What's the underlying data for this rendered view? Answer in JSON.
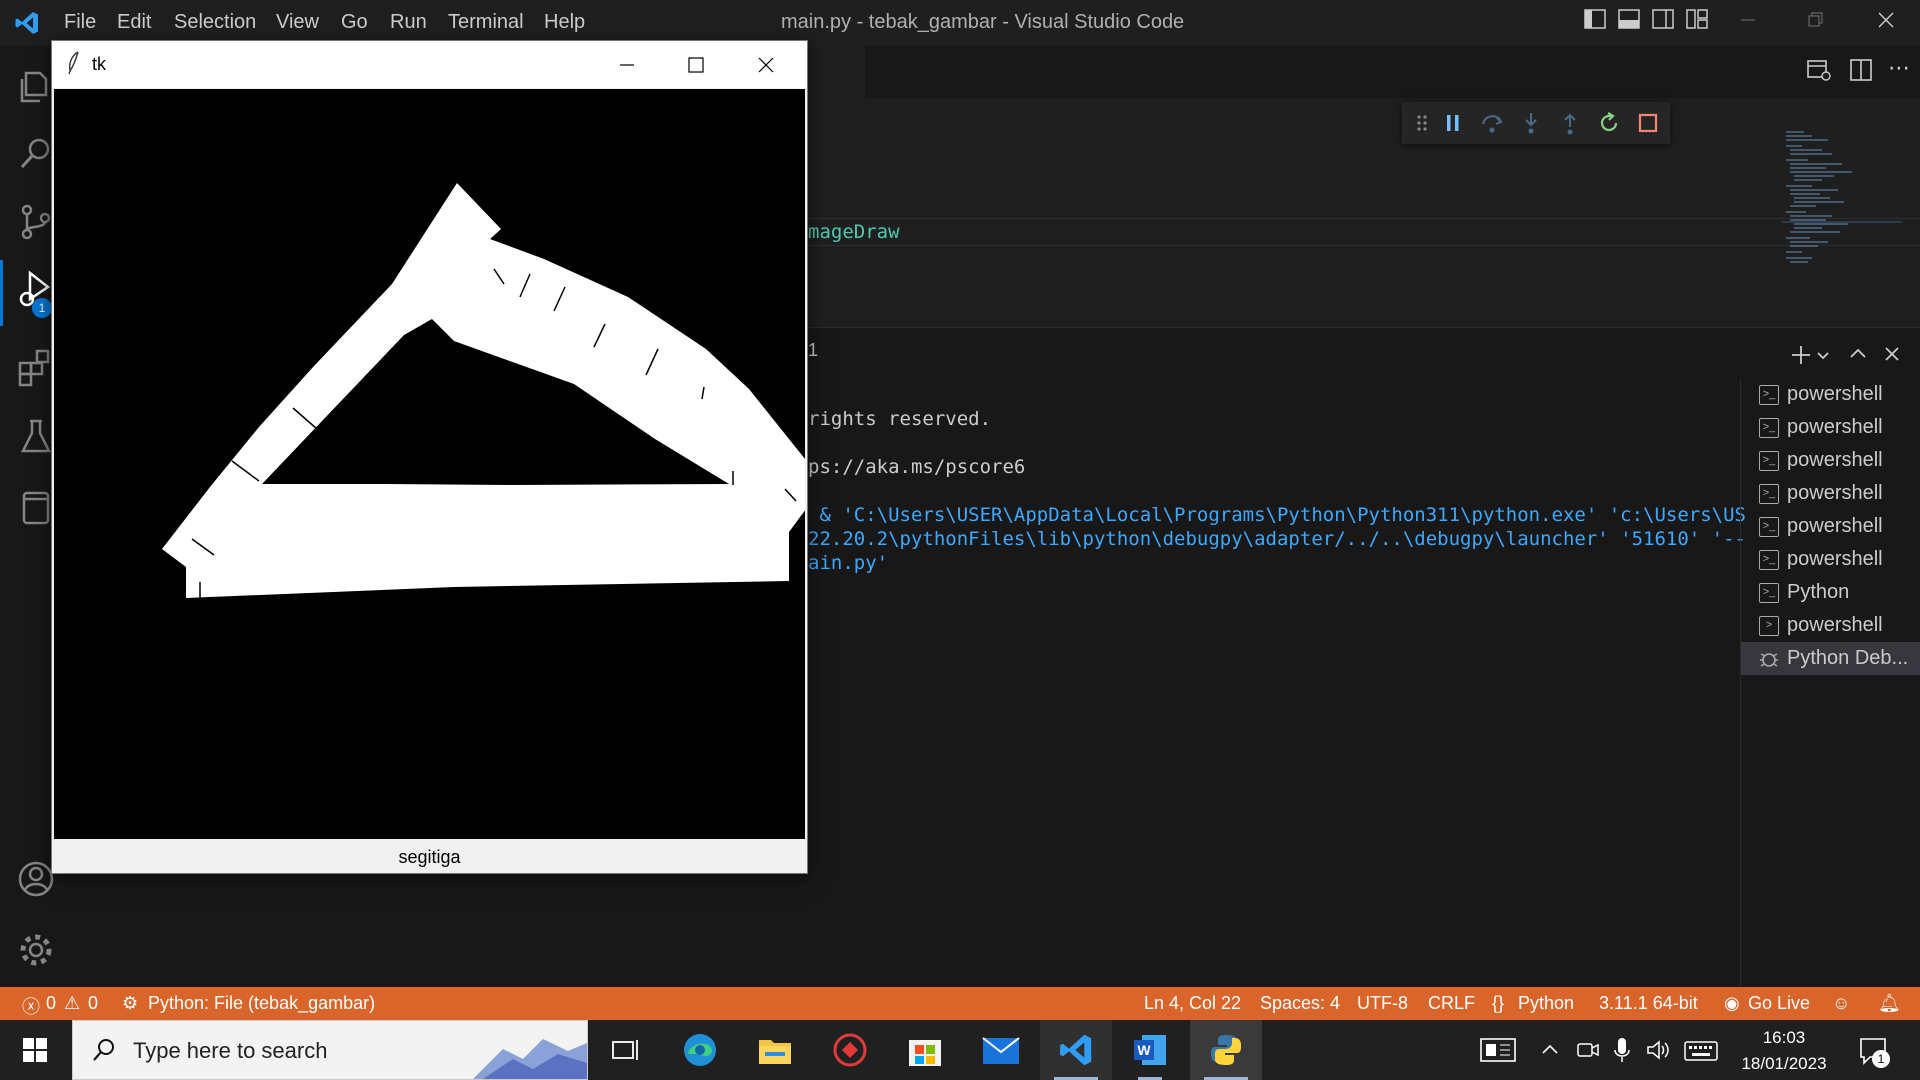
{
  "vscode": {
    "menu": [
      "File",
      "Edit",
      "Selection",
      "View",
      "Go",
      "Run",
      "Terminal",
      "Help"
    ],
    "window_title": "main.py - tebak_gambar - Visual Studio Code",
    "editor_fragment": "mageDraw",
    "terminal_lines": [
      "rights reserved.",
      "ps://aka.ms/pscore6",
      " & 'C:\\Users\\USER\\AppData\\Local\\Programs\\Python\\Python311\\python.exe' 'c:\\Users\\US",
      "22.20.2\\pythonFiles\\lib\\python\\debugpy\\adapter/../..\\debugpy\\launcher' '51610' '--",
      "ain.py'"
    ],
    "terminal_panel_fragment": "1",
    "terminals": [
      {
        "label": "powershell",
        "icon": "terminal-icon"
      },
      {
        "label": "powershell",
        "icon": "terminal-icon"
      },
      {
        "label": "powershell",
        "icon": "terminal-icon"
      },
      {
        "label": "powershell",
        "icon": "terminal-icon"
      },
      {
        "label": "powershell",
        "icon": "terminal-icon"
      },
      {
        "label": "powershell",
        "icon": "terminal-icon"
      },
      {
        "label": "Python",
        "icon": "terminal-icon"
      },
      {
        "label": "powershell",
        "icon": "terminal-icon"
      },
      {
        "label": "Python Deb...",
        "icon": "bug-icon",
        "active": true
      }
    ],
    "debug_badge": "1",
    "status": {
      "errors": "0",
      "warnings": "0",
      "debug_config": "Python: File (tebak_gambar)",
      "position": "Ln 4, Col 22",
      "spaces": "Spaces: 4",
      "encoding": "UTF-8",
      "eol": "CRLF",
      "language": "Python",
      "interpreter": "3.11.1 64-bit",
      "golive": "Go Live"
    },
    "colors": {
      "status_bar": "#d9652b",
      "accent": "#0078d4"
    }
  },
  "tk_window": {
    "title": "tk",
    "label": "segitiga"
  },
  "taskbar": {
    "search_placeholder": "Type here to search",
    "time": "16:03",
    "date": "18/01/2023",
    "notification_count": "1",
    "apps": [
      "task-view",
      "edge",
      "file-explorer",
      "security-app",
      "microsoft-store",
      "mail",
      "vscode",
      "word",
      "python"
    ]
  }
}
